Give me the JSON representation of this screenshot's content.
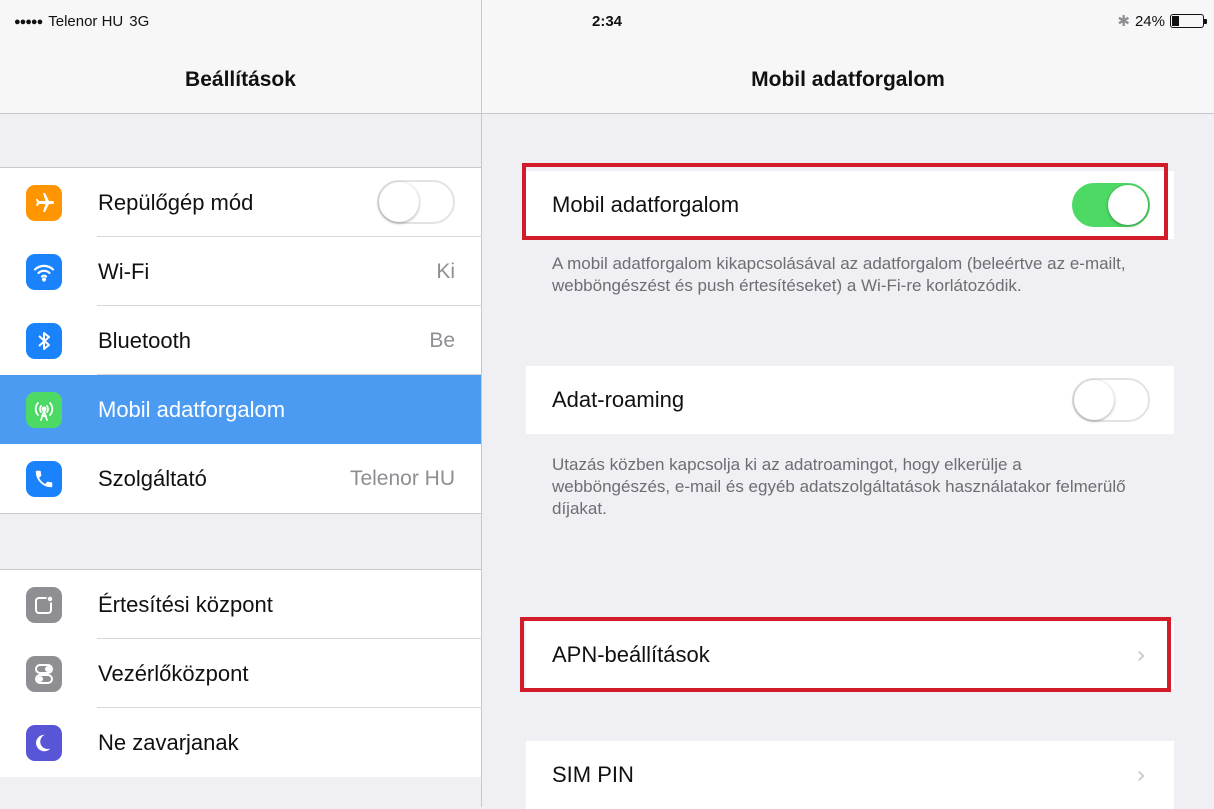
{
  "status_bar": {
    "signal_dots": "●●●●●",
    "carrier": "Telenor HU",
    "network": "3G",
    "time": "2:34",
    "battery_percent": "24%",
    "battery_level": 0.24,
    "bluetooth_icon": "bluetooth-icon"
  },
  "sidebar": {
    "title": "Beállítások",
    "groups": [
      {
        "items": [
          {
            "label": "Repülőgép mód",
            "icon": "airplane-icon",
            "icon_color": "#ff9500",
            "value": "",
            "toggle_on": false
          },
          {
            "label": "Wi-Fi",
            "icon": "wifi-icon",
            "icon_color": "#1a82fb",
            "value": "Ki"
          },
          {
            "label": "Bluetooth",
            "icon": "bluetooth-icon",
            "icon_color": "#1a82fb",
            "value": "Be"
          },
          {
            "label": "Mobil adatforgalom",
            "icon": "cellular-icon",
            "icon_color": "#4cd964",
            "value": "",
            "selected": true
          },
          {
            "label": "Szolgáltató",
            "icon": "phone-icon",
            "icon_color": "#1a82fb",
            "value": "Telenor HU"
          }
        ]
      },
      {
        "items": [
          {
            "label": "Értesítési központ",
            "icon": "notification-center-icon",
            "icon_color": "#8e8e93"
          },
          {
            "label": "Vezérlőközpont",
            "icon": "control-center-icon",
            "icon_color": "#8e8e93"
          },
          {
            "label": "Ne zavarjanak",
            "icon": "moon-icon",
            "icon_color": "#5856d6"
          }
        ]
      }
    ]
  },
  "detail": {
    "title": "Mobil adatforgalom",
    "mobile_data": {
      "label": "Mobil adatforgalom",
      "toggle_on": true,
      "footer": "A mobil adatforgalom kikapcsolásával az adatforgalom (beleértve az e-mailt, webböngészést és push értesítéseket) a Wi-Fi-re korlátozódik."
    },
    "roaming": {
      "label": "Adat-roaming",
      "toggle_on": false,
      "footer": "Utazás közben kapcsolja ki az adatroamingot, hogy elkerülje a webböngészés, e-mail és egyéb adatszolgáltatások használatakor felmerülő díjakat."
    },
    "apn": {
      "label": "APN-beállítások",
      "chevron": "›"
    },
    "sim_pin": {
      "label": "SIM PIN",
      "chevron": "›"
    }
  },
  "colors": {
    "highlight": "#d31c2a",
    "toggle_on": "#4cd964",
    "selection": "#4c9bf3"
  }
}
